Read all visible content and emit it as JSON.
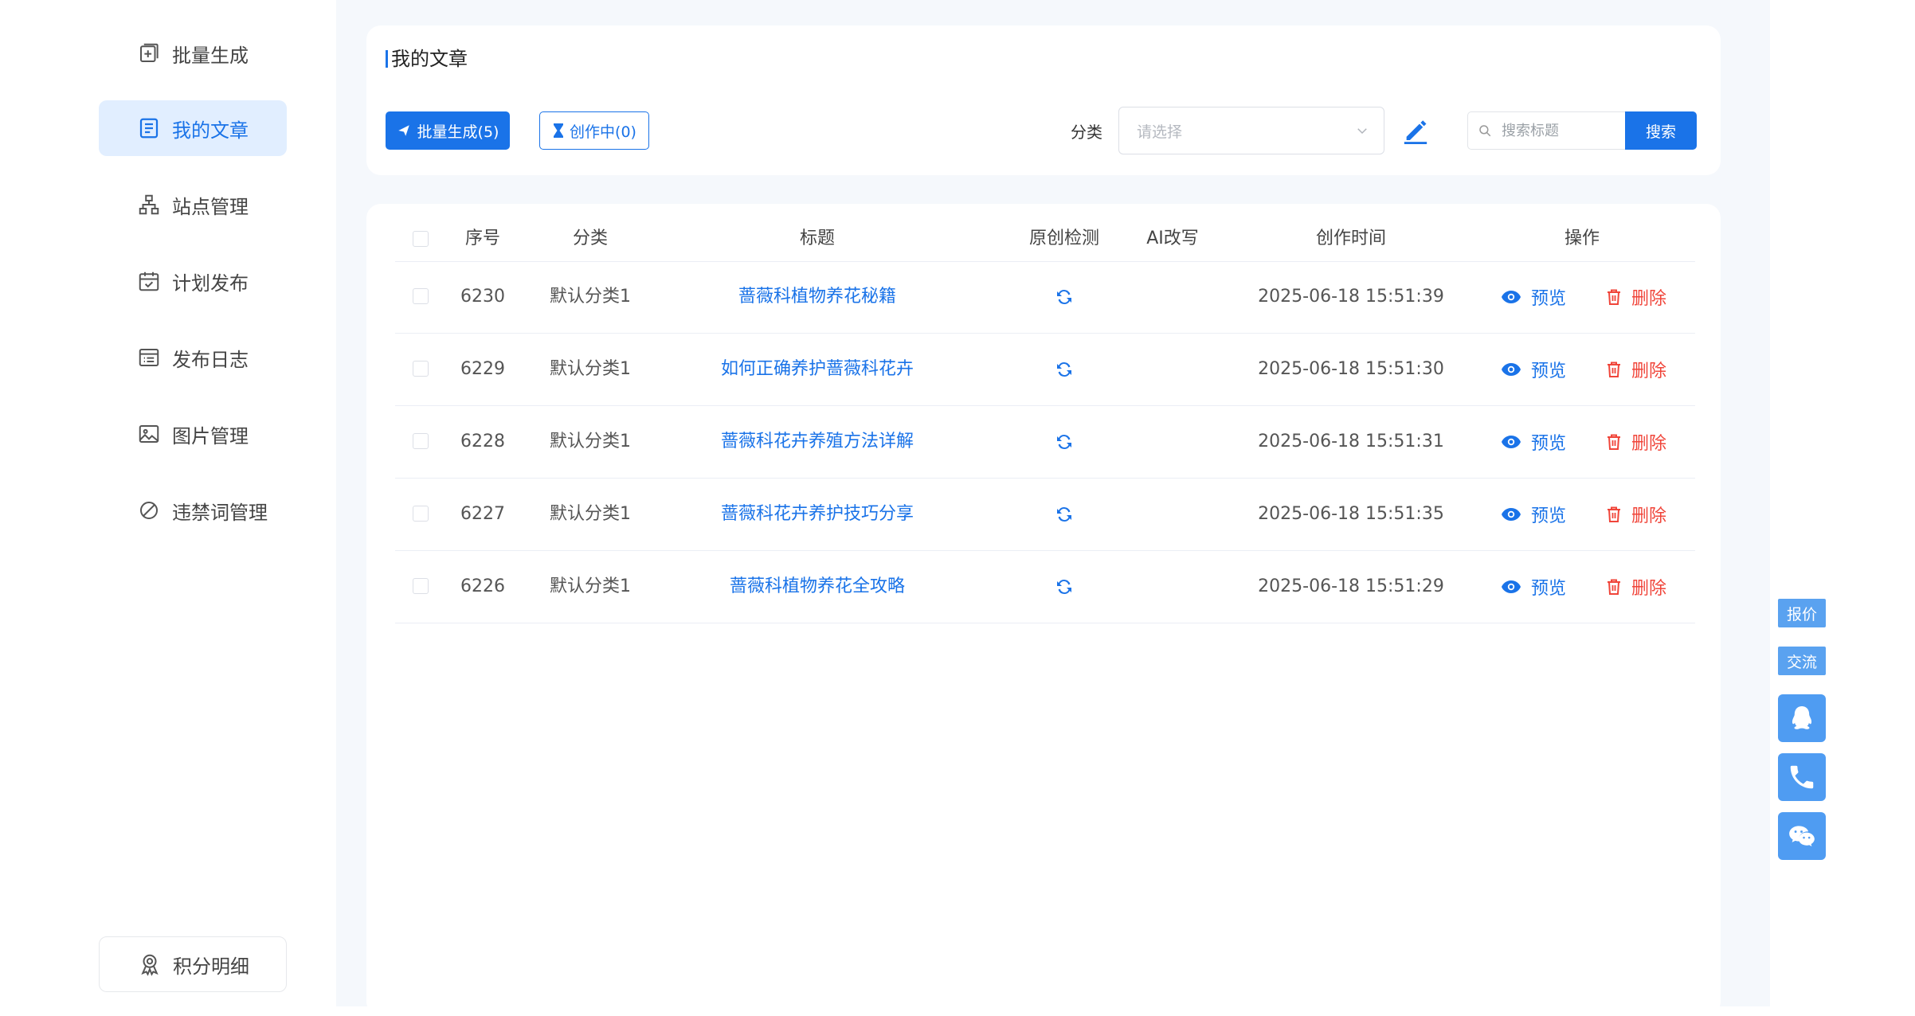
{
  "sidebar": {
    "items": [
      {
        "label": "批量生成",
        "icon": "plus-square-icon"
      },
      {
        "label": "我的文章",
        "icon": "document-icon",
        "active": true
      },
      {
        "label": "站点管理",
        "icon": "sitemap-icon"
      },
      {
        "label": "计划发布",
        "icon": "calendar-check-icon"
      },
      {
        "label": "发布日志",
        "icon": "log-list-icon"
      },
      {
        "label": "图片管理",
        "icon": "image-icon"
      },
      {
        "label": "违禁词管理",
        "icon": "forbidden-icon"
      }
    ],
    "points_label": "积分明细"
  },
  "header": {
    "title": "我的文章",
    "batch_button": "批量生成(5)",
    "creating_button": "创作中(0)",
    "category_label": "分类",
    "category_placeholder": "请选择",
    "search_placeholder": "搜索标题",
    "search_button": "搜索"
  },
  "table": {
    "columns": [
      "序号",
      "分类",
      "标题",
      "原创检测",
      "AI改写",
      "创作时间",
      "操作"
    ],
    "rows": [
      {
        "id": "6230",
        "category": "默认分类1",
        "title": "蔷薇科植物养花秘籍",
        "time": "2025-06-18 15:51:39"
      },
      {
        "id": "6229",
        "category": "默认分类1",
        "title": "如何正确养护蔷薇科花卉",
        "time": "2025-06-18 15:51:30"
      },
      {
        "id": "6228",
        "category": "默认分类1",
        "title": "蔷薇科花卉养殖方法详解",
        "time": "2025-06-18 15:51:31"
      },
      {
        "id": "6227",
        "category": "默认分类1",
        "title": "蔷薇科花卉养护技巧分享",
        "time": "2025-06-18 15:51:35"
      },
      {
        "id": "6226",
        "category": "默认分类1",
        "title": "蔷薇科植物养花全攻略",
        "time": "2025-06-18 15:51:29"
      }
    ],
    "preview_label": "预览",
    "delete_label": "删除"
  },
  "float": {
    "quote_label": "报价",
    "chat_label": "交流",
    "buttons": [
      "qq-icon",
      "phone-icon",
      "wechat-icon"
    ]
  },
  "colors": {
    "accent": "#1a73e8",
    "active_bg": "#e1eeff",
    "danger": "#f0453a",
    "float": "#4f9cf2"
  }
}
